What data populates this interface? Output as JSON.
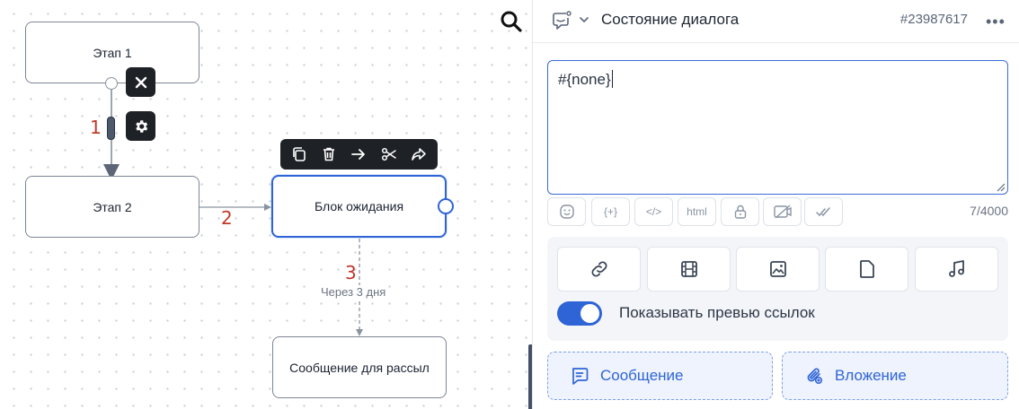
{
  "canvas": {
    "nodes": {
      "stage1": "Этап 1",
      "stage2": "Этап 2",
      "wait_block": "Блок ожидания",
      "broadcast": "Сообщение для рассыл"
    },
    "edge_labels": {
      "e1": "1",
      "e2": "2",
      "e3": "3"
    },
    "edge_delay": "Через 3 дня",
    "node_toolbar": [
      "copy-icon",
      "trash-icon",
      "arrow-right-icon",
      "scissors-icon",
      "forward-icon"
    ],
    "edge_actions": [
      "close-icon",
      "gear-icon"
    ],
    "colors": {
      "accent": "#2f64d6",
      "edge_label": "#c0392b",
      "toolbar_bg": "#1e2126"
    }
  },
  "panel": {
    "header": {
      "title": "Состояние диалога",
      "id": "#23987617",
      "more": "•••"
    },
    "editor": {
      "value": "#{none}"
    },
    "format_buttons": [
      "emoji-icon",
      "{+}",
      "</>",
      "html",
      "lock-icon",
      "no-preview-icon",
      "double-check-icon"
    ],
    "counter": "7/4000",
    "attachments": [
      "link-icon",
      "video-icon",
      "image-icon",
      "file-icon",
      "audio-icon"
    ],
    "link_preview": {
      "label": "Показывать превью ссылок",
      "enabled": true
    },
    "add_buttons": {
      "message": "Сообщение",
      "attachment": "Вложение"
    }
  }
}
